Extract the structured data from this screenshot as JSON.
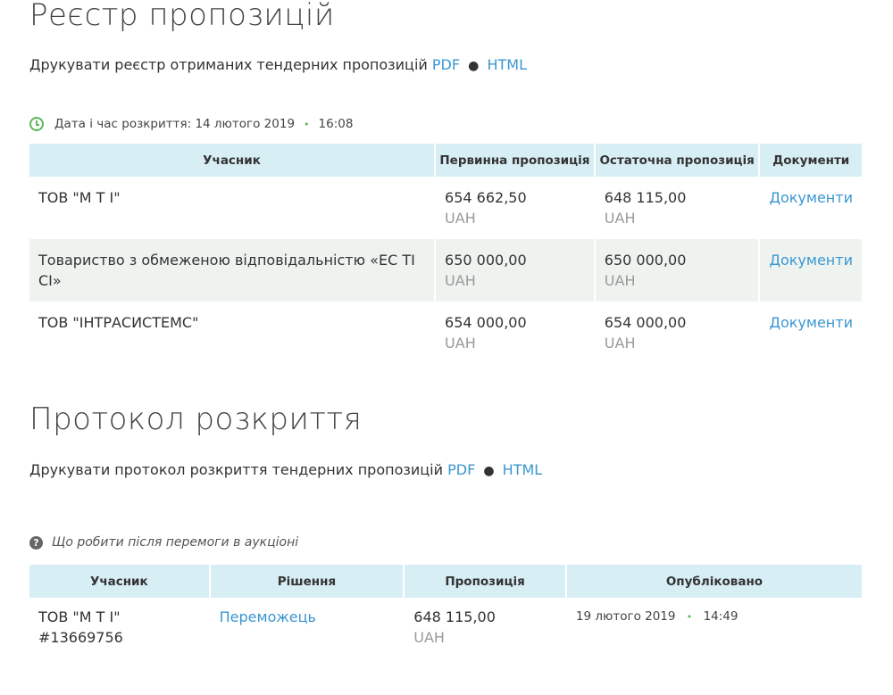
{
  "registry": {
    "title": "Реєстр пропозицій",
    "print_text": "Друкувати реєстр отриманих тендерних пропозицій",
    "pdf": "PDF",
    "html": "HTML",
    "dot": "●",
    "open_label": "Дата і час розкриття: 14 лютого 2019",
    "open_time": "16:08",
    "columns": [
      "Учасник",
      "Первинна пропозиція",
      "Остаточна пропозиція",
      "Документи"
    ],
    "rows": [
      {
        "participant": "ТОВ \"М Т І\"",
        "initial": "654 662,50",
        "final": "648 115,00",
        "currency": "UAH",
        "docs": "Документи"
      },
      {
        "participant": "Товариство з обмеженою відповідальністю «ЕС ТІ СІ»",
        "initial": "650 000,00",
        "final": "650 000,00",
        "currency": "UAH",
        "docs": "Документи"
      },
      {
        "participant": "ТОВ \"ІНТРАСИСТЕМС\"",
        "initial": "654 000,00",
        "final": "654 000,00",
        "currency": "UAH",
        "docs": "Документи"
      }
    ]
  },
  "protocol": {
    "title": "Протокол розкриття",
    "print_text": "Друкувати протокол розкриття тендерних пропозицій",
    "pdf": "PDF",
    "html": "HTML",
    "dot": "●",
    "help_text": "Що робити після перемоги в аукціоні",
    "columns": [
      "Учасник",
      "Рішення",
      "Пропозиція",
      "Опубліковано"
    ],
    "row": {
      "participant": "ТОВ \"М Т І\"",
      "participant_id": "#13669756",
      "decision": "Переможець",
      "offer": "648 115,00",
      "currency": "UAH",
      "published_date": "19 лютого 2019",
      "published_time": "14:49"
    }
  },
  "colors": {
    "accent": "#3a96d2",
    "header_bg": "#d8eef5",
    "green": "#5cb85c"
  }
}
